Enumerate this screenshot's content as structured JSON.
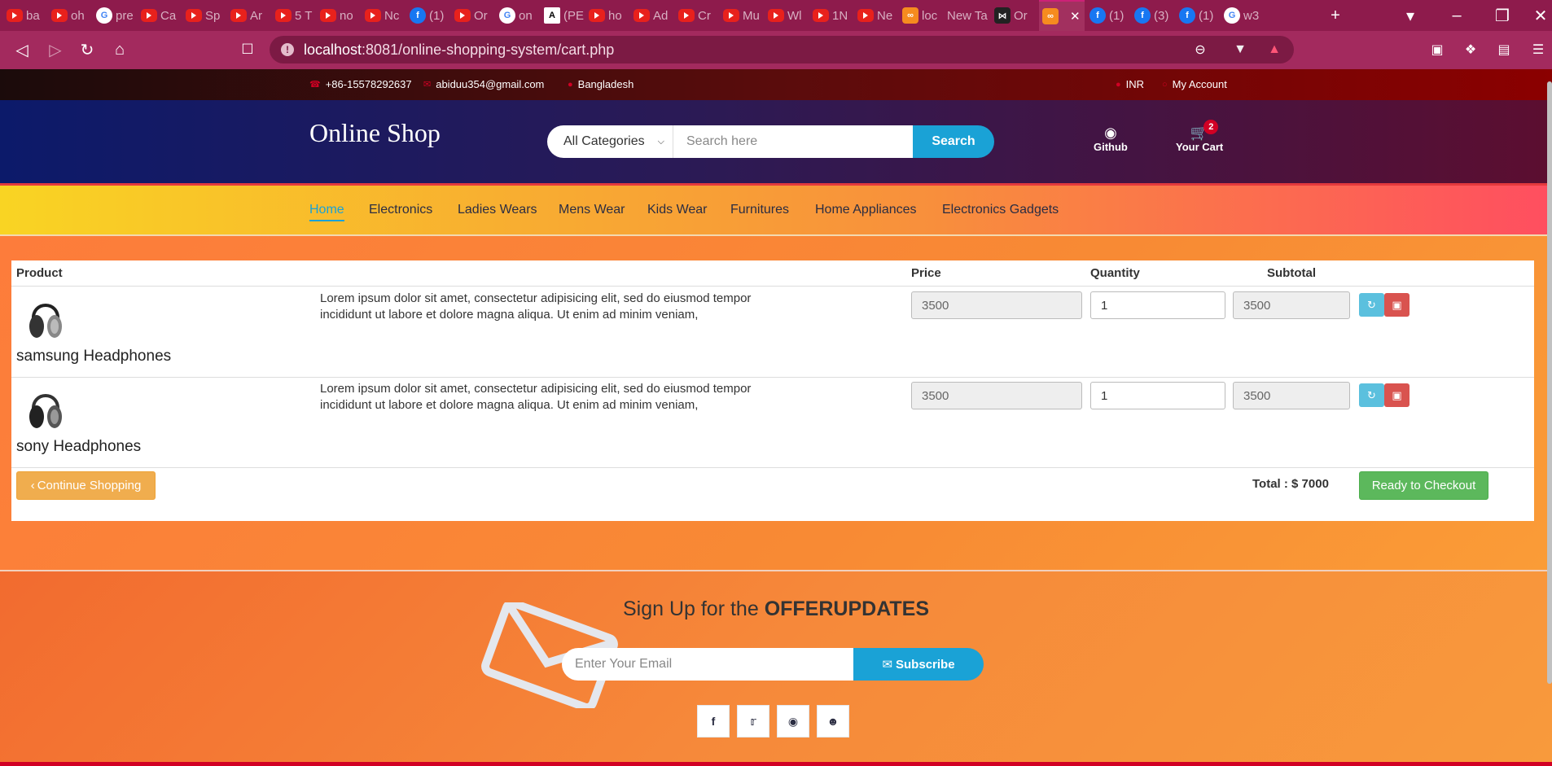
{
  "browser": {
    "tabs": [
      {
        "label": "ba",
        "icon": "youtube-icon"
      },
      {
        "label": "oh",
        "icon": "youtube-icon"
      },
      {
        "label": "pre",
        "icon": "google-icon"
      },
      {
        "label": "Ca",
        "icon": "youtube-icon"
      },
      {
        "label": "Sp",
        "icon": "youtube-icon"
      },
      {
        "label": "Ar",
        "icon": "youtube-icon"
      },
      {
        "label": "5 T",
        "icon": "youtube-icon"
      },
      {
        "label": "no",
        "icon": "youtube-icon"
      },
      {
        "label": "Nc",
        "icon": "youtube-icon"
      },
      {
        "label": "(1)",
        "icon": "facebook-icon"
      },
      {
        "label": "Or",
        "icon": "youtube-icon"
      },
      {
        "label": "on",
        "icon": "google-icon"
      },
      {
        "label": "(PE",
        "icon": "a-icon"
      },
      {
        "label": "ho",
        "icon": "youtube-icon"
      },
      {
        "label": "Ad",
        "icon": "youtube-icon"
      },
      {
        "label": "Cr",
        "icon": "youtube-icon"
      },
      {
        "label": "Mu",
        "icon": "youtube-icon"
      },
      {
        "label": "Wl",
        "icon": "youtube-icon"
      },
      {
        "label": "1N",
        "icon": "youtube-icon"
      },
      {
        "label": "Ne",
        "icon": "youtube-icon"
      },
      {
        "label": "loc",
        "icon": "xampp-icon"
      },
      {
        "label": "New Ta",
        "icon": ""
      },
      {
        "label": "Or",
        "icon": "bowtie-icon"
      },
      {
        "label": "",
        "icon": "xampp-icon",
        "active": true
      },
      {
        "label": "(1)",
        "icon": "facebook-icon"
      },
      {
        "label": "(3)",
        "icon": "facebook-icon"
      },
      {
        "label": "(1)",
        "icon": "facebook-icon"
      },
      {
        "label": "w3",
        "icon": "google-icon"
      }
    ],
    "url_host": "localhost",
    "url_rest": ":8081/online-shopping-system/cart.php"
  },
  "top_header": {
    "phone": "+86-15578292637",
    "email": "abiduu354@gmail.com",
    "location": "Bangladesh",
    "currency": "INR",
    "account": "My Account"
  },
  "header": {
    "logo": "Online Shop",
    "category_select": "All Categories",
    "search_placeholder": "Search here",
    "search_button": "Search",
    "github_label": "Github",
    "cart_label": "Your Cart",
    "cart_count": "2"
  },
  "nav": {
    "items": [
      "Home",
      "Electronics",
      "Ladies Wears",
      "Mens Wear",
      "Kids Wear",
      "Furnitures",
      "Home Appliances",
      "Electronics Gadgets"
    ],
    "active": "Home"
  },
  "cart": {
    "headers": {
      "product": "Product",
      "price": "Price",
      "quantity": "Quantity",
      "subtotal": "Subtotal"
    },
    "items": [
      {
        "name": "samsung Headphones",
        "description": "Lorem ipsum dolor sit amet, consectetur adipisicing elit, sed do eiusmod tempor incididunt ut labore et dolore magna aliqua. Ut enim ad minim veniam,",
        "price": "3500",
        "quantity": "1",
        "subtotal": "3500"
      },
      {
        "name": "sony Headphones",
        "description": "Lorem ipsum dolor sit amet, consectetur adipisicing elit, sed do eiusmod tempor incididunt ut labore et dolore magna aliqua. Ut enim ad minim veniam,",
        "price": "3500",
        "quantity": "1",
        "subtotal": "3500"
      }
    ],
    "continue_label": "Continue Shopping",
    "total_label": "Total : $ 7000",
    "checkout_label": "Ready to Checkout"
  },
  "newsletter": {
    "title_plain": "Sign Up for the ",
    "title_bold": "OFFERUPDATES",
    "email_placeholder": "Enter Your Email",
    "subscribe_label": "Subscribe",
    "social_icons": [
      "facebook-icon",
      "twitter-icon",
      "instagram-icon",
      "github-icon"
    ]
  },
  "colors": {
    "accent": "#1aa2d6",
    "brand_red": "#d10024",
    "success": "#5cb85c",
    "warning": "#f0ad4e",
    "danger": "#d9534f",
    "info": "#5bc0de"
  }
}
